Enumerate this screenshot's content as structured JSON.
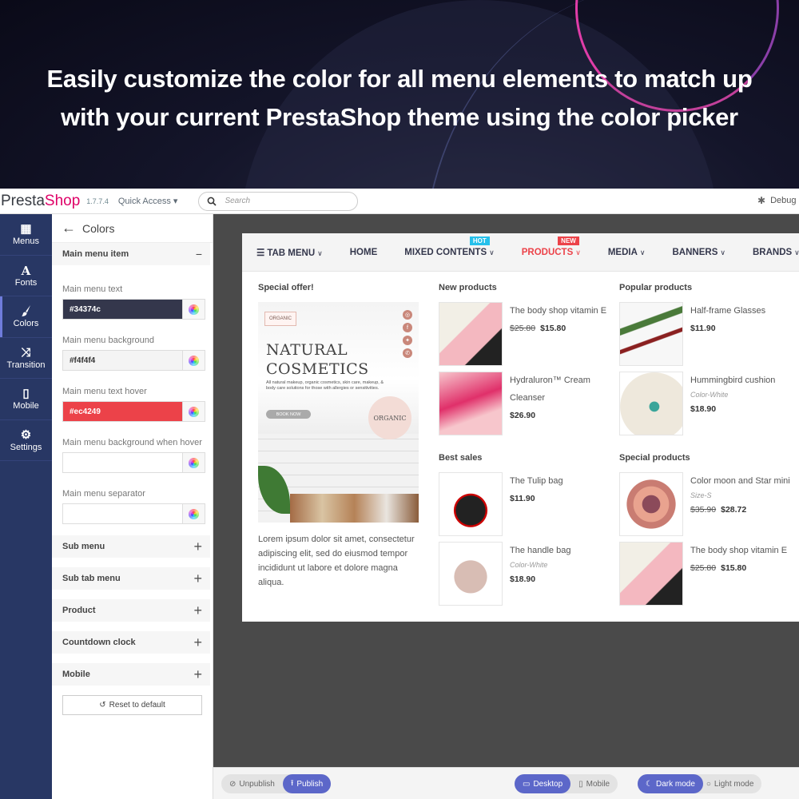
{
  "hero": {
    "headline_line1": "Easily customize the color for all menu elements to match up",
    "headline_line2": "with your current PrestaShop theme using the color picker"
  },
  "topbar": {
    "logo_part1": "Presta",
    "logo_part2": "Shop",
    "version": "1.7.7.4",
    "quick_access": "Quick Access ▾",
    "search_placeholder": "Search",
    "debug": "Debug"
  },
  "rail": [
    {
      "icon": "grid-icon",
      "glyph": "▦",
      "label": "Menus"
    },
    {
      "icon": "font-icon",
      "glyph": "A",
      "label": "Fonts"
    },
    {
      "icon": "brush-icon",
      "glyph": "🖌",
      "label": "Colors",
      "active": true
    },
    {
      "icon": "shuffle-icon",
      "glyph": "⤨",
      "label": "Transition"
    },
    {
      "icon": "mobile-icon",
      "glyph": "▯",
      "label": "Mobile"
    },
    {
      "icon": "gear-icon",
      "glyph": "⚙",
      "label": "Settings"
    }
  ],
  "panel": {
    "back_arrow": "←",
    "title": "Colors",
    "open_section": {
      "label": "Main menu item",
      "toggle": "−"
    },
    "fields": [
      {
        "label": "Main menu text",
        "value": "#34374c",
        "bg": "#34374c",
        "fg": "#ffffff"
      },
      {
        "label": "Main menu background",
        "value": "#f4f4f4",
        "bg": "#f4f4f4",
        "fg": "#333333"
      },
      {
        "label": "Main menu text hover",
        "value": "#ec4249",
        "bg": "#ec4249",
        "fg": "#ffffff"
      },
      {
        "label": "Main menu background when hover",
        "value": "",
        "bg": "#ffffff",
        "fg": "#333333"
      },
      {
        "label": "Main menu separator",
        "value": "",
        "bg": "#ffffff",
        "fg": "#333333"
      }
    ],
    "collapsed_sections": [
      "Sub menu",
      "Sub tab menu",
      "Product",
      "Countdown clock",
      "Mobile"
    ],
    "plus": "+",
    "reset_icon": "↺",
    "reset_label": "Reset to default"
  },
  "menu": {
    "items": [
      {
        "label": "TAB MENU",
        "icon": "☰",
        "chevron": true
      },
      {
        "label": "HOME",
        "chevron": false
      },
      {
        "label": "MIXED CONTENTS",
        "chevron": true,
        "badge": "HOT",
        "badge_type": "hot"
      },
      {
        "label": "PRODUCTS",
        "chevron": true,
        "badge": "NEW",
        "badge_type": "new",
        "active": true
      },
      {
        "label": "MEDIA",
        "chevron": true
      },
      {
        "label": "BANNERS",
        "chevron": true
      },
      {
        "label": "BRANDS",
        "chevron": true
      }
    ],
    "chevron": "⌄"
  },
  "content": {
    "special_offer": {
      "title": "Special offer!",
      "banner_tag": "ORGANIC",
      "banner_title_1": "NATURAL",
      "banner_title_2": "COSMETICS",
      "banner_desc": "All natural makeup, organic cosmetics, skin care, makeup, & body care solutions for those with allergies or sensitivities.",
      "banner_button": "BOOK NOW",
      "banner_seal": "ORGANIC",
      "social": [
        "◎",
        "f",
        "✦",
        "✆"
      ],
      "lorem": "Lorem ipsum dolor sit amet, consectetur adipiscing elit, sed do eiusmod tempor incididunt ut labore et dolore magna aliqua."
    },
    "new_products": {
      "title": "New products",
      "items": [
        {
          "name": "The body shop vitamin E",
          "old_price": "$25.80",
          "price": "$15.80",
          "attr": ""
        },
        {
          "name": "Hydraluron™ Cream Cleanser",
          "old_price": "",
          "price": "$26.90",
          "attr": ""
        }
      ]
    },
    "popular_products": {
      "title": "Popular products",
      "items": [
        {
          "name": "Half-frame Glasses",
          "old_price": "",
          "price": "$11.90",
          "attr": ""
        },
        {
          "name": "Hummingbird cushion",
          "old_price": "",
          "price": "$18.90",
          "attr": "Color-White"
        }
      ]
    },
    "best_sales": {
      "title": "Best sales",
      "items": [
        {
          "name": "The Tulip bag",
          "old_price": "",
          "price": "$11.90",
          "attr": ""
        },
        {
          "name": "The handle bag",
          "old_price": "",
          "price": "$18.90",
          "attr": "Color-White"
        }
      ]
    },
    "special_products": {
      "title": "Special products",
      "items": [
        {
          "name": "Color moon and Star mini",
          "old_price": "$35.90",
          "price": "$28.72",
          "attr": "Size-S"
        },
        {
          "name": "The body shop vitamin E",
          "old_price": "$25.80",
          "price": "$15.80",
          "attr": ""
        }
      ]
    }
  },
  "bottombar": {
    "unpublish": "Unpublish",
    "publish": "Publish",
    "desktop": "Desktop",
    "mobile": "Mobile",
    "dark_mode": "Dark mode",
    "light_mode": "Light mode"
  },
  "colors": {
    "accent": "#5c67c9",
    "rail_bg": "#283764",
    "menu_text": "#34374c",
    "menu_hover": "#ec4249",
    "menu_bg": "#f4f4f4",
    "hot": "#25c0eb"
  }
}
